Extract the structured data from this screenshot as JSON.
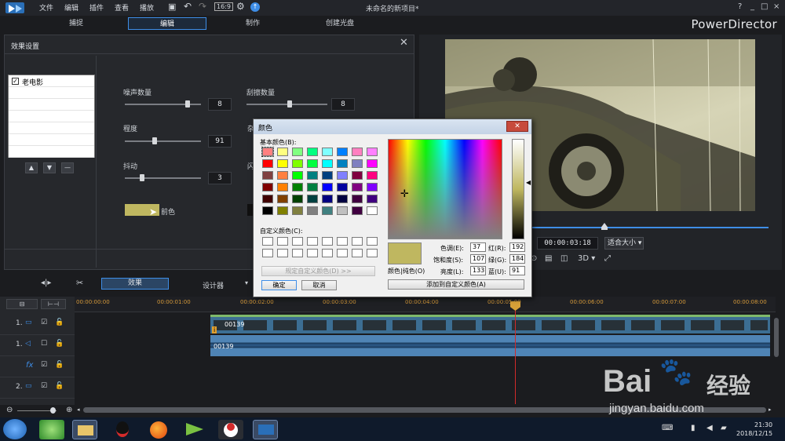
{
  "app": {
    "title": "未命名的新项目*",
    "brand": "PowerDirector",
    "menu": [
      "文件",
      "编辑",
      "插件",
      "查看",
      "播放"
    ],
    "window_controls": [
      "?",
      "_",
      "□",
      "×"
    ]
  },
  "tabs": [
    {
      "label": "捕捉",
      "active": false
    },
    {
      "label": "编辑",
      "active": true
    },
    {
      "label": "制作",
      "active": false
    },
    {
      "label": "创建光盘",
      "active": false
    }
  ],
  "effect_panel": {
    "title": "效果设置",
    "list_item": "老电影",
    "params": {
      "noise": {
        "label": "噪声数量",
        "value": "8",
        "level": 0.95
      },
      "scratch": {
        "label": "刮擦数量",
        "value": "8",
        "level": 0.3
      },
      "degree": {
        "label": "程度",
        "value": "91",
        "level": 0.4
      },
      "jitter": {
        "label": "抖动",
        "value": "3",
        "level": 0.22
      },
      "flicker_partial": {
        "label": "杂"
      },
      "flash_partial": {
        "label": "闪"
      }
    },
    "foreground_label": "前色",
    "swatch_color": "#bfb760"
  },
  "preview": {
    "timecode": "00:00:03:18",
    "fit": "适合大小",
    "mode_3d": "3D ▾",
    "seek_position": 0.76
  },
  "edit_toolbar": {
    "effects": "效果",
    "designer": "设计器"
  },
  "timeline": {
    "ticks": [
      "00:00:00:00",
      "00:00:01:00",
      "00:00:02:00",
      "00:00:03:00",
      "00:00:04:00",
      "00:00:05:00",
      "00:00:06:00",
      "00:00:07:00",
      "00:00:08:00"
    ],
    "tracks": [
      {
        "label": "1.",
        "type": "video-track-icon"
      },
      {
        "label": "1.",
        "type": "audio-track-icon"
      },
      {
        "label": "fx",
        "type": "fx-track-icon"
      },
      {
        "label": "2.",
        "type": "video-track-icon"
      }
    ],
    "video_clip_label": "00139",
    "audio_clip_label": "00139"
  },
  "color_dialog": {
    "title": "颜色",
    "basic_colors_label": "基本颜色(B):",
    "custom_colors_label": "自定义颜色(C):",
    "define_custom_button": "规定自定义颜色(D) >>",
    "ok_button": "确定",
    "cancel_button": "取消",
    "color_solid_label": "颜色|纯色(O)",
    "add_custom_button": "添加到自定义颜色(A)",
    "hue": {
      "label": "色调(E):",
      "value": "37"
    },
    "sat": {
      "label": "饱和度(S):",
      "value": "107"
    },
    "lum": {
      "label": "亮度(L):",
      "value": "133"
    },
    "red": {
      "label": "红(R):",
      "value": "192"
    },
    "green": {
      "label": "绿(G):",
      "value": "184"
    },
    "blue": {
      "label": "蓝(U):",
      "value": "91"
    },
    "basic_colors": [
      "#ff8080",
      "#ffff80",
      "#80ff80",
      "#00ff80",
      "#80ffff",
      "#0080ff",
      "#ff80c0",
      "#ff80ff",
      "#ff0000",
      "#ffff00",
      "#80ff00",
      "#00ff40",
      "#00ffff",
      "#0080c0",
      "#8080c0",
      "#ff00ff",
      "#804040",
      "#ff8040",
      "#00ff00",
      "#008080",
      "#004080",
      "#8080ff",
      "#800040",
      "#ff0080",
      "#800000",
      "#ff8000",
      "#008000",
      "#008040",
      "#0000ff",
      "#0000a0",
      "#800080",
      "#8000ff",
      "#400000",
      "#804000",
      "#004000",
      "#004040",
      "#000080",
      "#000040",
      "#400040",
      "#400080",
      "#000000",
      "#808000",
      "#808040",
      "#808080",
      "#408080",
      "#c0c0c0",
      "#400040",
      "#ffffff"
    ]
  },
  "taskbar": {
    "time": "21:30",
    "date": "2018/12/15"
  },
  "watermark": {
    "line1": "Bai",
    "line2": "经验",
    "url": "jingyan.baidu.com"
  }
}
